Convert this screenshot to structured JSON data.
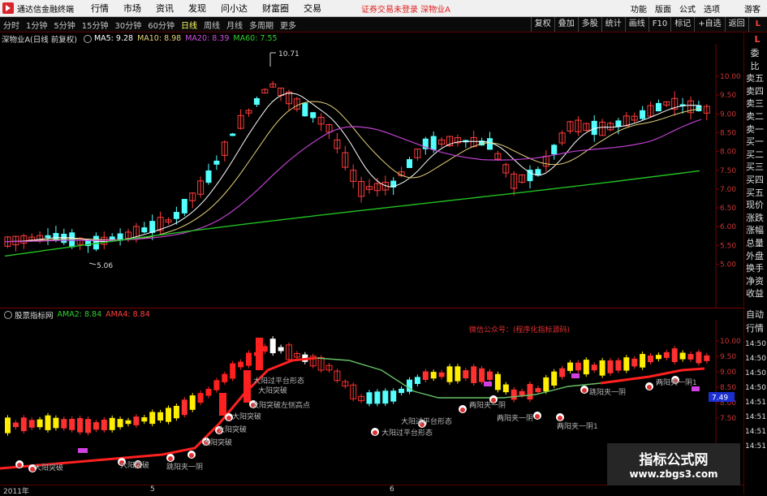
{
  "menubar": {
    "app_title": "通达信金融终端",
    "items": [
      "行情",
      "市场",
      "资讯",
      "发现",
      "问小达",
      "财富圈",
      "交易"
    ],
    "notice": "证券交易未登录 深物业A",
    "right": [
      "功能",
      "版面",
      "公式",
      "选项"
    ],
    "user": "游客"
  },
  "toolbar": {
    "periods": [
      "分时",
      "1分钟",
      "5分钟",
      "15分钟",
      "30分钟",
      "60分钟",
      "日线",
      "周线",
      "月线",
      "多周期",
      "更多"
    ],
    "tools": [
      "复权",
      "叠加",
      "多股",
      "统计",
      "画线",
      "F10",
      "标记",
      "+自选",
      "返回"
    ],
    "corner": "L"
  },
  "main_legend": {
    "title": "深物业A(日线 前复权)",
    "ma5": "MA5: 9.28",
    "ma10": "MA10: 8.98",
    "ma20": "MA20: 8.39",
    "ma60": "MA60: 7.55"
  },
  "main_chart": {
    "price_axis": [
      "10.00",
      "9.50",
      "9.00",
      "8.50",
      "8.00",
      "7.50",
      "7.00",
      "6.50",
      "6.00",
      "5.50",
      "5.00"
    ],
    "high_label": "10.71",
    "low_label": "5.06",
    "colors": {
      "up": "#ff3c3c",
      "down": "#54ffff",
      "ma5": "#ffffff",
      "ma10": "#e6d27a",
      "ma20": "#c040d0",
      "ma60": "#22c022"
    }
  },
  "sub_legend": {
    "title": "股票指标网",
    "ama2": "AMA2: 8.84",
    "ama4": "AMA4: 8.84"
  },
  "sub_chart": {
    "price_axis": [
      "10.00",
      "9.50",
      "9.00",
      "8.50",
      "8.00",
      "7.50"
    ],
    "current_price": "7.49",
    "wechat": "微信公众号：(程序化指标源码)",
    "annotations": [
      "大阳突破",
      "大阳突破",
      "跳阳夹一阴",
      "大阳突破",
      "大阳突破",
      "大阳过平台形态",
      "大阳突破",
      "大阳突破左侧高点",
      "大阳突破",
      "大阳过平台形态",
      "两阳夹一阴",
      "两阳夹一阴",
      "大阳过平台形态",
      "两阳夹一阴1",
      "跳阳夹一阴",
      "两阳夹一阴1"
    ]
  },
  "date_axis": [
    "2011年",
    "5",
    "6"
  ],
  "side_panel": {
    "top_tabs": [
      "委",
      "比",
      "卖五",
      "卖四",
      "卖三",
      "卖二",
      "卖一",
      "买一",
      "买二",
      "买三",
      "买四",
      "买五",
      "现价",
      "涨跌",
      "涨幅",
      "总量",
      "外盘",
      "换手",
      "净资",
      "收益"
    ],
    "bottom_tabs": [
      "自动",
      "行情"
    ],
    "times": [
      "14:50",
      "14:50",
      "14:50",
      "14:50",
      "14:51",
      "14:51",
      "14:51",
      "14:51"
    ],
    "corner": "L"
  },
  "watermark": {
    "line1": "指标公式网",
    "line2": "www.zbgs3.com"
  }
}
